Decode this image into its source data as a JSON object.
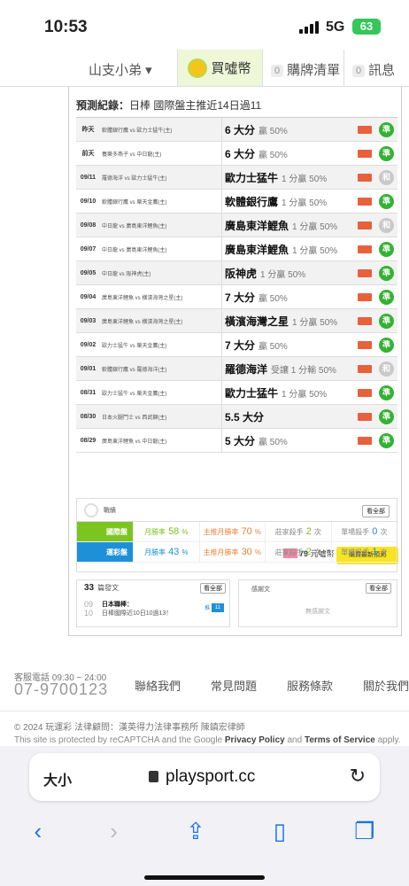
{
  "status": {
    "time": "10:53",
    "network": "5G",
    "battery": "63"
  },
  "nav": {
    "user": "山支小弟 ▾",
    "buy_label": "買噓幣",
    "cart_count": "0",
    "cart_label": "購牌清單",
    "msg_count": "0",
    "msg_label": "訊息"
  },
  "panel": {
    "title_bold": "預測紀錄：",
    "title_rest": "日棒 國際盤主推近14日過11",
    "rows": [
      {
        "date": "昨天",
        "game": "軟體銀行鷹 vs 歐力士猛牛(主)",
        "pick": "6 大分",
        "result": "贏 50%",
        "status": "準"
      },
      {
        "date": "前天",
        "game": "養樂多燕子 vs 中日龍(主)",
        "pick": "6 大分",
        "result": "贏 50%",
        "status": "準"
      },
      {
        "date": "09/11",
        "game": "羅德海洋 vs 歐力士猛牛(主)",
        "pick": "歐力士猛牛",
        "result": "1 分贏 50%",
        "status": "和"
      },
      {
        "date": "09/10",
        "game": "軟體銀行鷹 vs 樂天金鷹(主)",
        "pick": "軟體銀行鷹",
        "result": "1 分贏 50%",
        "status": "準"
      },
      {
        "date": "09/08",
        "game": "中日龍 vs 廣島東洋鯉魚(主)",
        "pick": "廣島東洋鯉魚",
        "result": "1 分贏 50%",
        "status": "和"
      },
      {
        "date": "09/07",
        "game": "中日龍 vs 廣島東洋鯉魚(主)",
        "pick": "廣島東洋鯉魚",
        "result": "1 分贏 50%",
        "status": "準"
      },
      {
        "date": "09/05",
        "game": "中日龍 vs 阪神虎(主)",
        "pick": "阪神虎",
        "result": "1 分贏 50%",
        "status": "準"
      },
      {
        "date": "09/04",
        "game": "廣島東洋鯉魚 vs 橫濱海灣之星(主)",
        "pick": "7 大分",
        "result": "贏 50%",
        "status": "準"
      },
      {
        "date": "09/03",
        "game": "廣島東洋鯉魚 vs 橫濱海灣之星(主)",
        "pick": "橫濱海灣之星",
        "result": "1 分贏 50%",
        "status": "準"
      },
      {
        "date": "09/02",
        "game": "歐力士猛牛 vs 樂天金鷹(主)",
        "pick": "7 大分",
        "result": "贏 50%",
        "status": "準"
      },
      {
        "date": "09/01",
        "game": "軟體銀行鷹 vs 羅德海洋(主)",
        "pick": "羅德海洋",
        "result": "受讓 1 分輸 50%",
        "status": "和"
      },
      {
        "date": "08/31",
        "game": "歐力士猛牛 vs 樂天金鷹(主)",
        "pick": "歐力士猛牛",
        "result": "1 分贏 50%",
        "status": "準"
      },
      {
        "date": "08/30",
        "game": "日本火腿鬥士 vs 西武獅(主)",
        "pick": "5.5 大分",
        "result": "",
        "status": "準"
      },
      {
        "date": "08/29",
        "game": "廣島東洋鯉魚 vs 中日龍(主)",
        "pick": "5 大分",
        "result": "贏 50%",
        "status": "準"
      }
    ],
    "price": "79",
    "price_unit": "元噓幣",
    "buy_latest": "購買最新預測"
  },
  "stats": {
    "title": "戰績",
    "all": "看全部",
    "rows": [
      {
        "label": "國際盤",
        "color": "#7ac520",
        "c1_label": "月勝率",
        "c1_val": "58",
        "c2_label": "主推月勝率",
        "c2_val": "70",
        "c3_label": "莊家殺手",
        "c3_val": "2",
        "c4_label": "單場殺手",
        "c4_val": "0"
      },
      {
        "label": "運彩盤",
        "color": "#1e90d8",
        "c1_label": "月勝率",
        "c1_val": "43",
        "c2_label": "主推月勝率",
        "c2_val": "30",
        "c3_label": "莊家殺手",
        "c3_val": "2",
        "c4_label": "單場殺手",
        "c4_val": "1"
      }
    ]
  },
  "posts": {
    "count": "33",
    "label": "篇發文",
    "all": "看全部",
    "date_top": "09",
    "date_bot": "10",
    "title": "日本職棒：",
    "sub": "日棒國際近10日10過13！",
    "tag_label": "推",
    "tag_val": "11"
  },
  "thanks": {
    "label": "感謝文",
    "all": "看全部",
    "empty": "無感謝文"
  },
  "footer": {
    "hotline_label": "客服電話 09:30 ~ 24:00",
    "phone": "07-9700123",
    "links": [
      "聯絡我們",
      "常見問題",
      "服務條款",
      "關於我們"
    ],
    "copyright": "© 2024 玩運彩 法律顧問：漢英得力法律事務所 陳鎮宏律師",
    "recaptcha_a": "This site is protected by reCAPTCHA and the Google ",
    "recaptcha_b": "Privacy Policy",
    "recaptcha_c": " and ",
    "recaptcha_d": "Terms of Service",
    "recaptcha_e": " apply."
  },
  "safari": {
    "text_size": "大小",
    "url": "playsport.cc"
  }
}
